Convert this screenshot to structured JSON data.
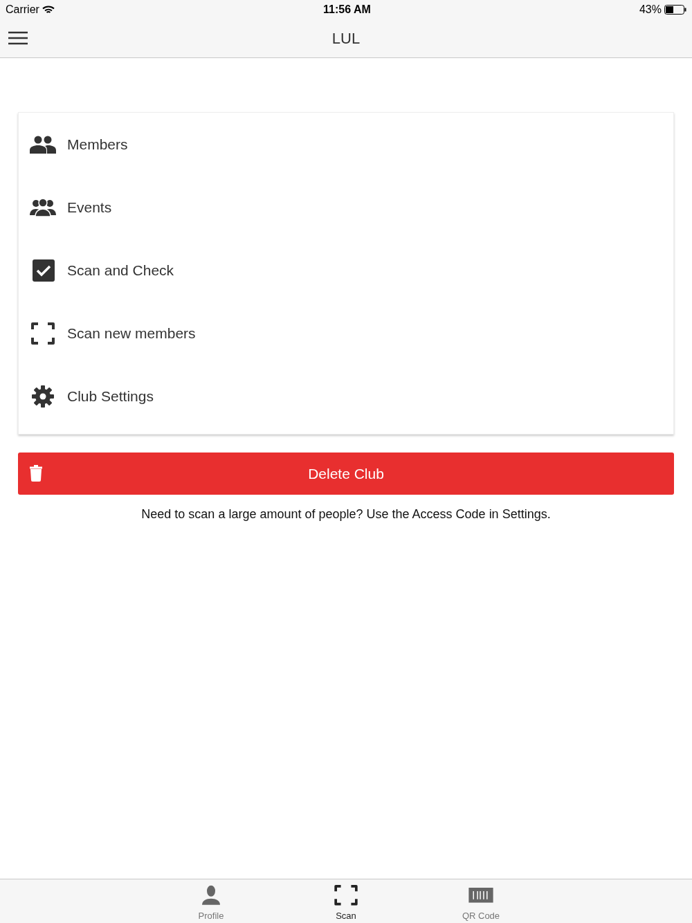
{
  "status_bar": {
    "carrier": "Carrier",
    "time": "11:56 AM",
    "battery": "43%"
  },
  "nav_bar": {
    "title": "LUL"
  },
  "menu": [
    {
      "kind": "members",
      "label": "Members"
    },
    {
      "kind": "events",
      "label": "Events"
    },
    {
      "kind": "check",
      "label": "Scan and Check"
    },
    {
      "kind": "scan",
      "label": "Scan new members"
    },
    {
      "kind": "settings",
      "label": "Club Settings"
    }
  ],
  "delete_button": {
    "label": "Delete Club"
  },
  "hint": "Need to scan a large amount of people? Use the Access Code in Settings.",
  "tab_bar": [
    {
      "kind": "profile",
      "label": "Profile",
      "selected": false
    },
    {
      "kind": "scan",
      "label": "Scan",
      "selected": true
    },
    {
      "kind": "qr",
      "label": "QR Code",
      "selected": false
    }
  ]
}
